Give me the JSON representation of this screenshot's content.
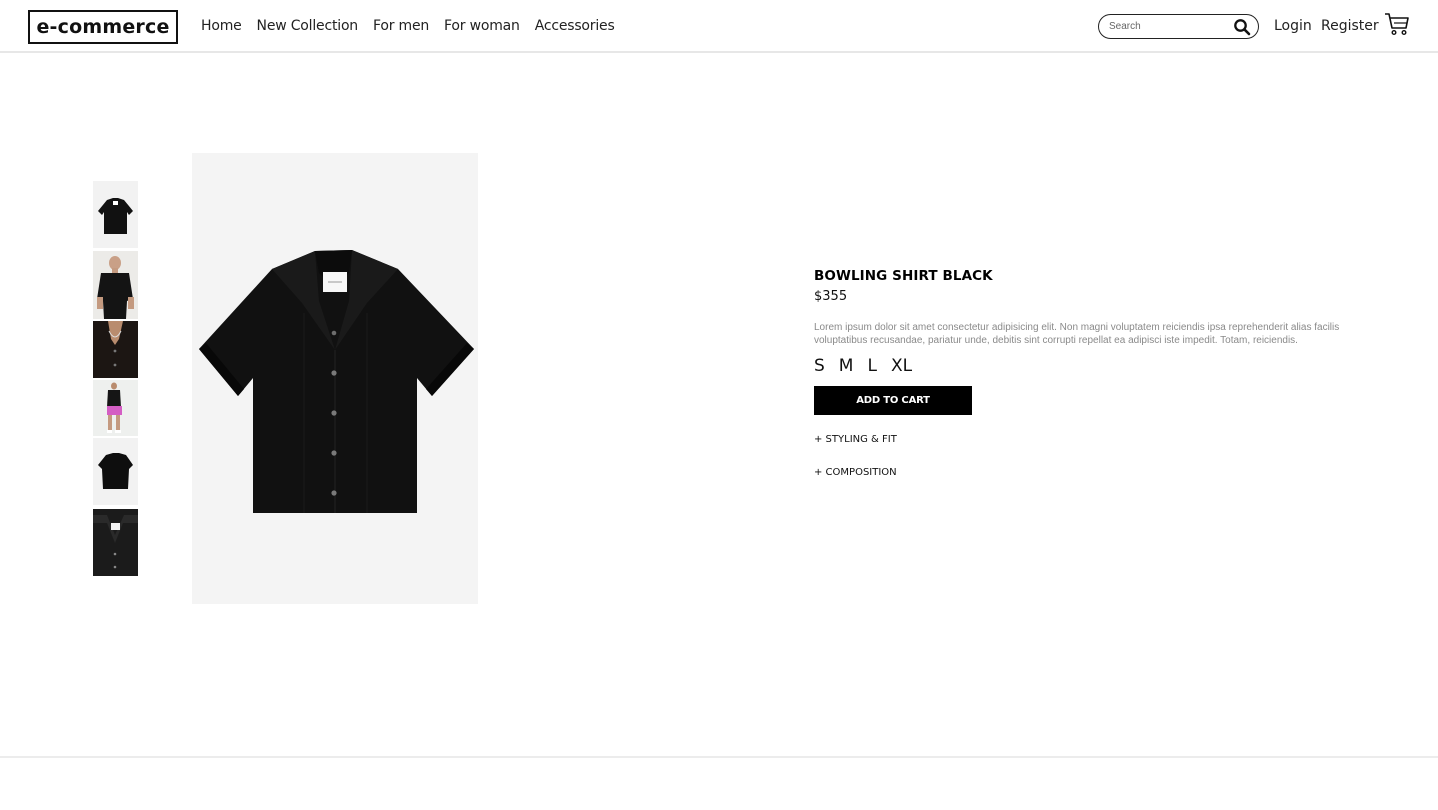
{
  "header": {
    "logo": "e-commerce",
    "nav": [
      "Home",
      "New Collection",
      "For men",
      "For woman",
      "Accessories"
    ],
    "search_placeholder": "Search",
    "login": "Login",
    "register": "Register"
  },
  "product": {
    "title": "BOWLING SHIRT BLACK",
    "price": "$355",
    "description": "Lorem ipsum dolor sit amet consectetur adipisicing elit. Non magni voluptatem reiciendis ipsa reprehenderit alias facilis voluptatibus recusandae, pariatur unde, debitis sint corrupti repellat ea adipisci iste impedit. Totam, reiciendis.",
    "sizes": [
      "S",
      "M",
      "L",
      "XL"
    ],
    "add_to_cart": "ADD TO CART",
    "styling_fit": "+ STYLING & FIT",
    "composition": "+ COMPOSITION"
  },
  "colors": {
    "accent": "#000000",
    "image_bg": "#f4f4f4"
  },
  "icons": [
    "search-icon",
    "cart-icon"
  ]
}
